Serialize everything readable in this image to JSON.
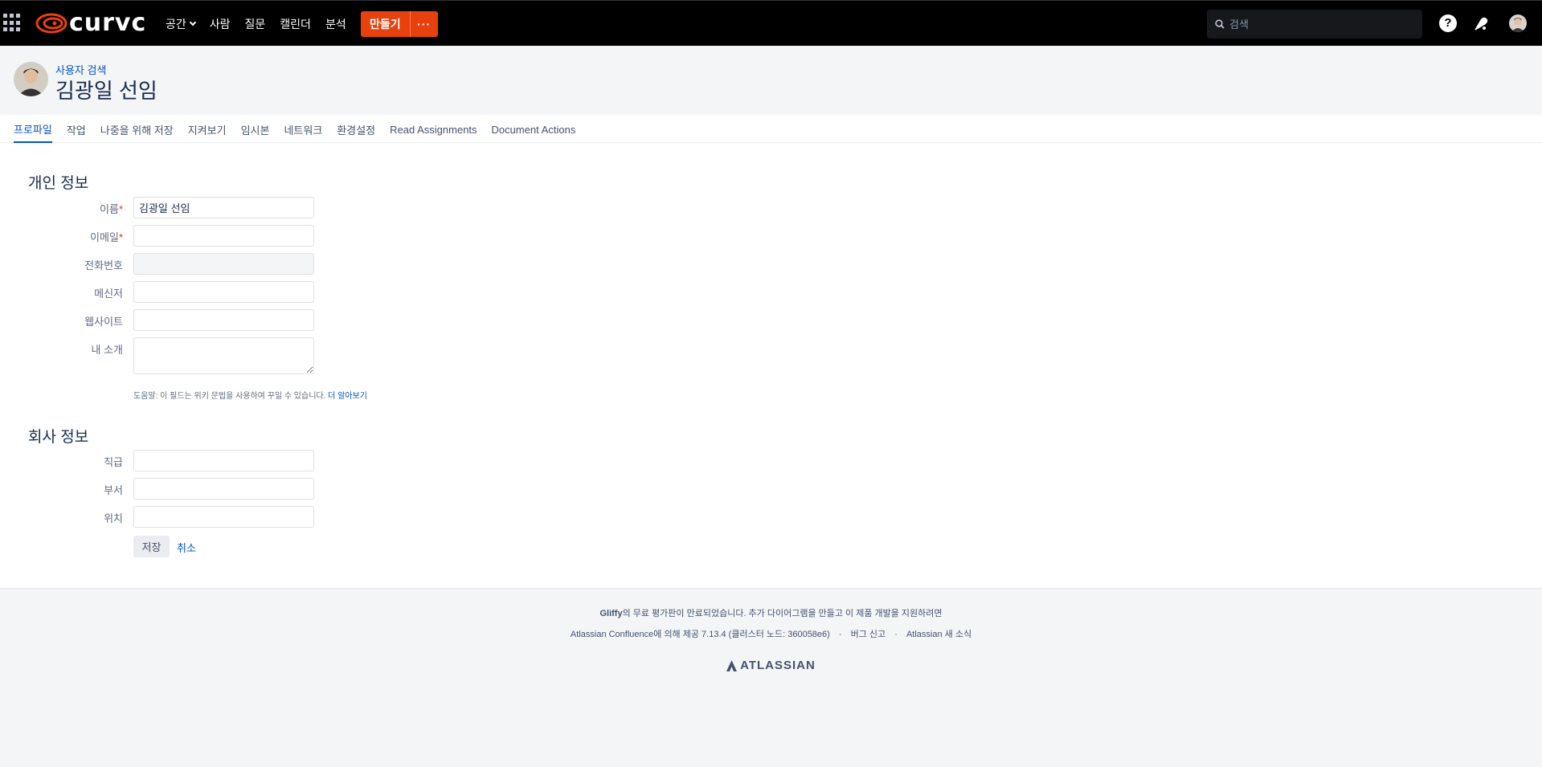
{
  "topbar": {
    "logo_text": "curvc",
    "nav": [
      {
        "label": "공간",
        "dropdown": true
      },
      {
        "label": "사람"
      },
      {
        "label": "질문"
      },
      {
        "label": "캘린더"
      },
      {
        "label": "분석"
      }
    ],
    "create_label": "만들기",
    "more_label": "···",
    "search_placeholder": "검색",
    "help_label": "?"
  },
  "header": {
    "breadcrumb": "사용자 검색",
    "title": "김광일 선임"
  },
  "tabs": [
    {
      "label": "프로파일",
      "active": true
    },
    {
      "label": "작업"
    },
    {
      "label": "나중을 위해 저장"
    },
    {
      "label": "지켜보기"
    },
    {
      "label": "임시본"
    },
    {
      "label": "네트워크"
    },
    {
      "label": "환경설정"
    },
    {
      "label": "Read Assignments"
    },
    {
      "label": "Document Actions"
    }
  ],
  "personal": {
    "title": "개인 정보",
    "name_label": "이름",
    "name_value": "김광일 선임",
    "email_label": "이메일",
    "phone_label": "전화번호",
    "messenger_label": "메신저",
    "website_label": "웹사이트",
    "about_label": "내 소개",
    "required_mark": "*",
    "help_text": "도움말: 이 필드는 위키 문법을 사용하여 꾸밀 수 있습니다.",
    "help_link": "더 알아보기"
  },
  "company": {
    "title": "회사 정보",
    "position_label": "직급",
    "department_label": "부서",
    "location_label": "위치"
  },
  "actions": {
    "save_label": "저장",
    "cancel_label": "취소"
  },
  "footer": {
    "gliffy_bold": "Gliffy",
    "gliffy_text": "의 무료 평가판이 만료되었습니다. 추가 다이어그램을 만들고 이 제품 개발을 지원하려면",
    "powered_by": "Atlassian Confluence에 의해 제공 7.13.4 (클러스터 노드: 360058e6)",
    "bug_report": "버그 신고",
    "news": "Atlassian 새 소식",
    "separator": "·",
    "atlassian_logo_text": "ATLASSIAN"
  },
  "colors": {
    "brand_orange": "#e8410e",
    "link_blue": "#0052cc",
    "topbar_bg": "#000000"
  }
}
